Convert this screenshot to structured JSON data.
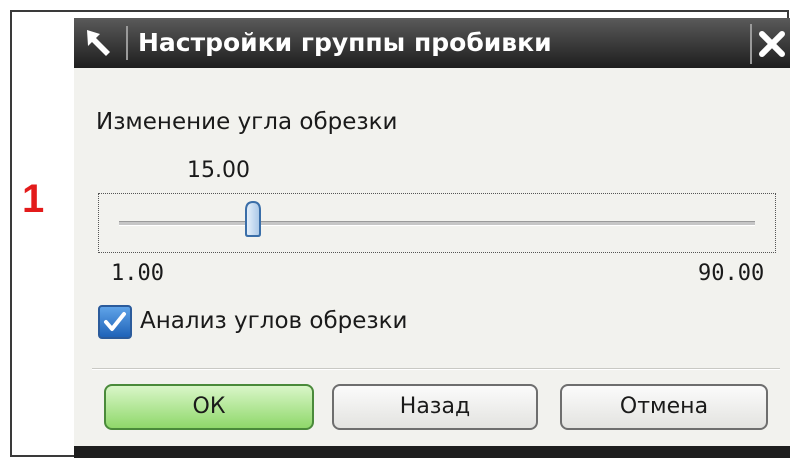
{
  "annotation": {
    "marker": "1",
    "color": "#e31b1b"
  },
  "dialog": {
    "title": "Настройки группы пробивки",
    "pin_icon": "pin-arrow-icon",
    "close_icon": "close-icon"
  },
  "trim_angle": {
    "label": "Изменение угла обрезки",
    "value_display": "15.00",
    "value": 15.0,
    "min_label": "1.00",
    "max_label": "90.00",
    "min": 1.0,
    "max": 90.0
  },
  "analysis": {
    "label": "Анализ углов обрезки",
    "checked": true
  },
  "buttons": {
    "ok": "ОК",
    "back": "Назад",
    "cancel": "Отмена"
  },
  "colors": {
    "titlebar": "#2a2a2a",
    "ok_button": "#8fd86a",
    "checkbox": "#1f63b8"
  }
}
